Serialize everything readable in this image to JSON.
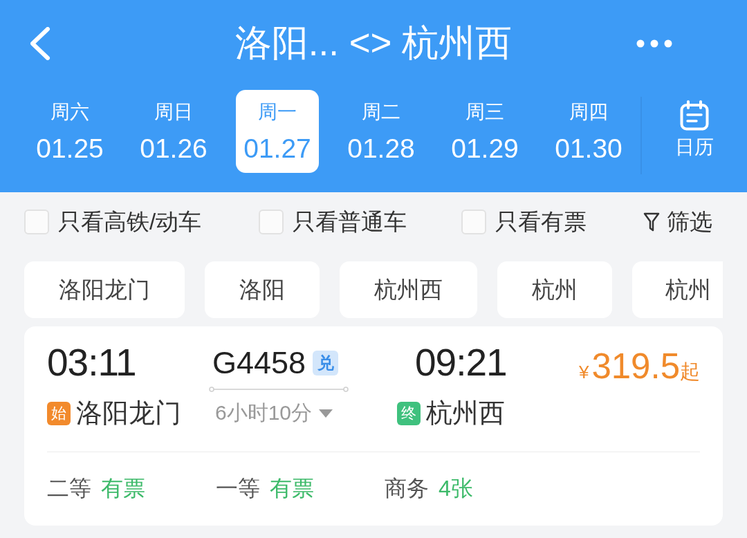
{
  "header": {
    "title": "洛阳... <> 杭州西"
  },
  "dates": [
    {
      "weekday": "周六",
      "date": "01.25",
      "selected": false
    },
    {
      "weekday": "周日",
      "date": "01.26",
      "selected": false
    },
    {
      "weekday": "周一",
      "date": "01.27",
      "selected": true
    },
    {
      "weekday": "周二",
      "date": "01.28",
      "selected": false
    },
    {
      "weekday": "周三",
      "date": "01.29",
      "selected": false
    },
    {
      "weekday": "周四",
      "date": "01.30",
      "selected": false
    }
  ],
  "calendar": {
    "label": "日历"
  },
  "filters": [
    {
      "label": "只看高铁/动车",
      "checked": false
    },
    {
      "label": "只看普通车",
      "checked": false
    },
    {
      "label": "只看有票",
      "checked": false
    }
  ],
  "filter_button": {
    "label": "筛选"
  },
  "stations": [
    {
      "name": "洛阳龙门"
    },
    {
      "name": "洛阳"
    },
    {
      "name": "杭州西"
    },
    {
      "name": "杭州"
    },
    {
      "name": "杭州"
    }
  ],
  "train": {
    "departure_time": "03:11",
    "departure_tag": "始",
    "departure_station": "洛阳龙门",
    "number": "G4458",
    "number_tag": "兑",
    "duration": "6小时10分",
    "arrival_time": "09:21",
    "arrival_tag": "终",
    "arrival_station": "杭州西",
    "price": {
      "currency": "¥",
      "amount": "319.5",
      "suffix": "起"
    },
    "seats": [
      {
        "class": "二等",
        "availability": "有票"
      },
      {
        "class": "一等",
        "availability": "有票"
      },
      {
        "class": "商务",
        "availability": "4张"
      }
    ]
  }
}
